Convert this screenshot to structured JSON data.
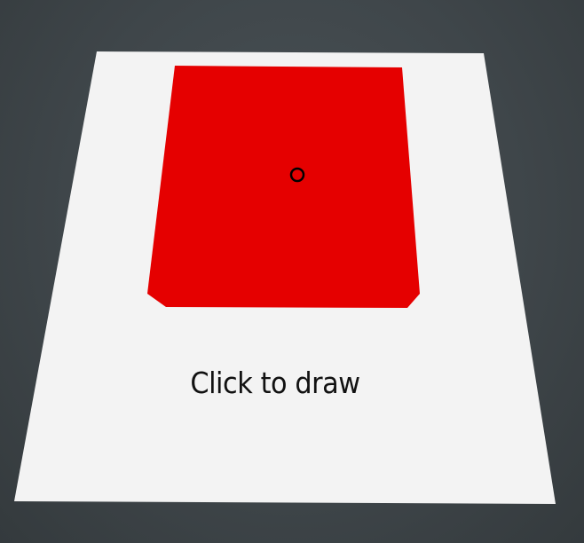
{
  "canvas": {
    "instruction": "Click to draw",
    "background_color": "#3f464a",
    "paper_color": "#f3f3f3",
    "drawing_color": "#e50000",
    "cursor_icon": "circle-cursor-icon"
  }
}
